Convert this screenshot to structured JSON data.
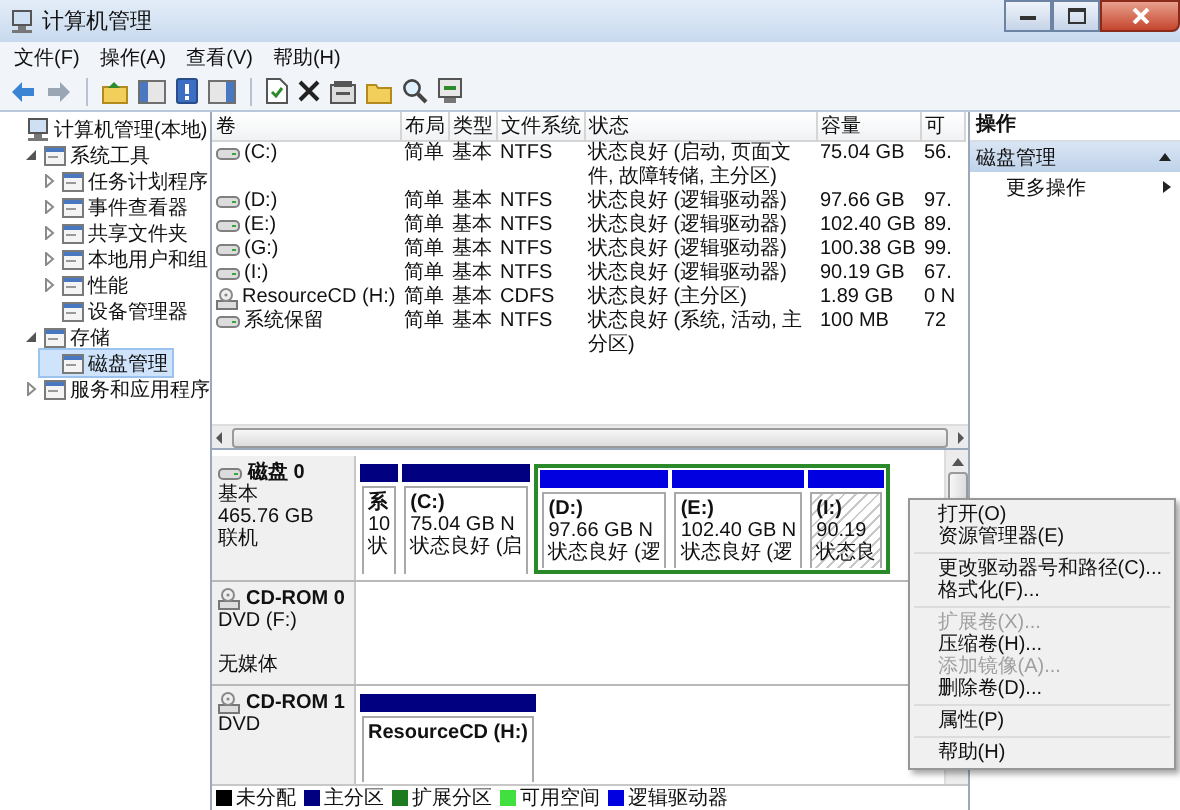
{
  "window": {
    "title": "计算机管理"
  },
  "menu": [
    "文件(F)",
    "操作(A)",
    "查看(V)",
    "帮助(H)"
  ],
  "tree": [
    {
      "label": "计算机管理(本地)",
      "expandable": false,
      "selected": false,
      "children": [
        {
          "label": "系统工具",
          "expandable": true,
          "expanded": true,
          "selected": false,
          "children": [
            {
              "label": "任务计划程序",
              "expandable": true,
              "expanded": false,
              "selected": false
            },
            {
              "label": "事件查看器",
              "expandable": true,
              "expanded": false,
              "selected": false
            },
            {
              "label": "共享文件夹",
              "expandable": true,
              "expanded": false,
              "selected": false
            },
            {
              "label": "本地用户和组",
              "expandable": true,
              "expanded": false,
              "selected": false
            },
            {
              "label": "性能",
              "expandable": true,
              "expanded": false,
              "selected": false
            },
            {
              "label": "设备管理器",
              "expandable": false,
              "selected": false
            }
          ]
        },
        {
          "label": "存储",
          "expandable": true,
          "expanded": true,
          "selected": false,
          "children": [
            {
              "label": "磁盘管理",
              "expandable": false,
              "selected": true
            }
          ]
        },
        {
          "label": "服务和应用程序",
          "expandable": true,
          "expanded": false,
          "selected": false
        }
      ]
    }
  ],
  "table": {
    "columns": [
      "卷",
      "布局",
      "类型",
      "文件系统",
      "状态",
      "容量",
      "可"
    ],
    "rows": [
      {
        "kind": "disk",
        "cells": [
          "(C:)",
          "简单",
          "基本",
          "NTFS",
          "状态良好 (启动, 页面文件, 故障转储, 主分区)",
          "75.04 GB",
          "56."
        ]
      },
      {
        "kind": "disk",
        "cells": [
          "(D:)",
          "简单",
          "基本",
          "NTFS",
          "状态良好 (逻辑驱动器)",
          "97.66 GB",
          "97."
        ]
      },
      {
        "kind": "disk",
        "cells": [
          "(E:)",
          "简单",
          "基本",
          "NTFS",
          "状态良好 (逻辑驱动器)",
          "102.40 GB",
          "89."
        ]
      },
      {
        "kind": "disk",
        "cells": [
          "(G:)",
          "简单",
          "基本",
          "NTFS",
          "状态良好 (逻辑驱动器)",
          "100.38 GB",
          "99."
        ]
      },
      {
        "kind": "disk",
        "cells": [
          "(I:)",
          "简单",
          "基本",
          "NTFS",
          "状态良好 (逻辑驱动器)",
          "90.19 GB",
          "67."
        ]
      },
      {
        "kind": "cd",
        "cells": [
          "ResourceCD (H:)",
          "简单",
          "基本",
          "CDFS",
          "状态良好 (主分区)",
          "1.89 GB",
          "0 N"
        ]
      },
      {
        "kind": "disk",
        "cells": [
          "系统保留",
          "简单",
          "基本",
          "NTFS",
          "状态良好 (系统, 活动, 主分区)",
          "100 MB",
          "72"
        ]
      }
    ]
  },
  "disks": [
    {
      "kind": "disk",
      "name": "磁盘 0",
      "lines": [
        "基本",
        "465.76 GB",
        "联机"
      ],
      "primary_partitions": [
        {
          "lines": [
            "系",
            "10",
            "状"
          ],
          "color": "#000080",
          "selected": false
        },
        {
          "lines": [
            "(C:)",
            "75.04 GB N",
            "状态良好 (启"
          ],
          "color": "#000080",
          "selected": false
        }
      ],
      "extended_partition": {
        "partitions": [
          {
            "lines": [
              "(D:)",
              "97.66 GB N",
              "状态良好 (逻"
            ],
            "color": "#0000e0",
            "selected": false
          },
          {
            "lines": [
              "(E:)",
              "102.40 GB N",
              "状态良好 (逻"
            ],
            "color": "#0000e0",
            "selected": false
          },
          {
            "lines": [
              "(I:)",
              "90.19",
              "状态良"
            ],
            "color": "#0000e0",
            "selected": true
          }
        ]
      }
    },
    {
      "kind": "cdrom",
      "name": "CD-ROM 0",
      "lines": [
        "DVD (F:)",
        "无媒体"
      ]
    },
    {
      "kind": "cdrom",
      "name": "CD-ROM 1",
      "lines": [
        "DVD"
      ],
      "primary_partitions": [
        {
          "lines": [
            "ResourceCD  (H:)"
          ],
          "color": "#000080",
          "selected": false
        }
      ]
    }
  ],
  "legend": [
    {
      "label": "未分配",
      "color": "#000000"
    },
    {
      "label": "主分区",
      "color": "#000080"
    },
    {
      "label": "扩展分区",
      "color": "#1e7a1e"
    },
    {
      "label": "可用空间",
      "color": "#40e040"
    },
    {
      "label": "逻辑驱动器",
      "color": "#0000e0"
    }
  ],
  "actions": {
    "header": "操作",
    "sections": [
      {
        "title": "磁盘管理",
        "expanded": true,
        "items": [
          "更多操作"
        ]
      }
    ]
  },
  "context_menu": {
    "groups": [
      {
        "items": [
          {
            "label": "打开(O)",
            "disabled": false
          },
          {
            "label": "资源管理器(E)",
            "disabled": false
          }
        ]
      },
      {
        "items": [
          {
            "label": "更改驱动器号和路径(C)...",
            "disabled": false
          },
          {
            "label": "格式化(F)...",
            "disabled": false
          }
        ]
      },
      {
        "items": [
          {
            "label": "扩展卷(X)...",
            "disabled": true
          },
          {
            "label": "压缩卷(H)...",
            "disabled": false
          },
          {
            "label": "添加镜像(A)...",
            "disabled": true
          },
          {
            "label": "删除卷(D)...",
            "disabled": false
          }
        ]
      },
      {
        "items": [
          {
            "label": "属性(P)",
            "disabled": false
          }
        ]
      },
      {
        "items": [
          {
            "label": "帮助(H)",
            "disabled": false
          }
        ]
      }
    ]
  }
}
